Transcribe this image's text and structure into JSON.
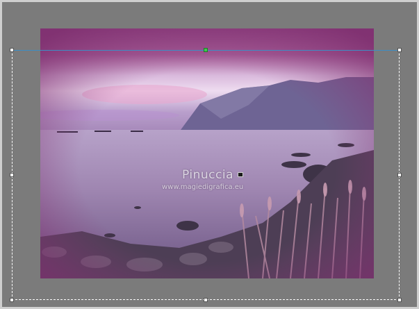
{
  "canvas": {
    "background_color": "#7b7b7b",
    "photo_tint_color": "#8a4a80",
    "selection_border_color": "#ffffff",
    "center_handle_color": "#3ec94b"
  },
  "watermark": {
    "signature": "Pinuccia",
    "url": "www.magiedigrafica.eu"
  },
  "icons": {
    "pivot": "pivot-point-icon",
    "handles": "resize-handle-icon"
  }
}
